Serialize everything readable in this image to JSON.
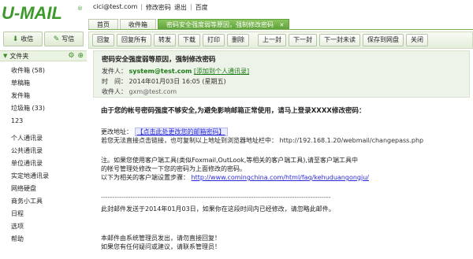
{
  "logo": {
    "brand": "U-MAIL",
    "reg": "®"
  },
  "left_toolbar": {
    "receive": "收信",
    "write": "写信"
  },
  "folder_header": {
    "label": "文件夹"
  },
  "folders": [
    "收件箱 (58)",
    "草稿箱",
    "发件箱",
    "垃圾箱 (33)",
    "123"
  ],
  "nav": [
    "个人通讯录",
    "公共通讯录",
    "单位通讯录",
    "实定地通讯录",
    "网络硬盘",
    "商务小工具",
    "日程",
    "选项",
    "帮助"
  ],
  "userbar": {
    "email": "cici@test.com",
    "sep1": "|",
    "change_pwd": "修改密码",
    "logout": "退出",
    "sep2": "|",
    "baidu": "百度"
  },
  "tabs": [
    {
      "label": "首页"
    },
    {
      "label": "收件箱"
    },
    {
      "label": "密码安全强度弱等原因，强制修改密码",
      "close": "✕"
    }
  ],
  "toolbar": [
    "回复",
    "回复所有",
    "转发",
    "下载",
    "打印",
    "删除",
    "上一封",
    "下一封",
    "下一封未读",
    "保存到网盘",
    "关闭"
  ],
  "message": {
    "subject": "密码安全强度弱等原因，强制修改密码",
    "sender_label": "发件人：",
    "sender": "system@test.com",
    "add_contact": "[添加到个人通讯录]",
    "time_label": "时　间：",
    "time": "2014年01月03日 16:05 (星期五)",
    "recipient_label": "收件人：",
    "recipient": "gxm@test.com"
  },
  "body": {
    "title": "由于您的帐号密码强度不够安全,为避免影响邮箱正常使用，请马上登录XXXX修改密码：",
    "change_label": "更改地址：",
    "change_link": "【点击此处更改您的邮箱密码】",
    "copy_hint": "若您无法直接点击链接，也可复制以上地址到浏览器地址栏中：",
    "copy_url": "http://192.168.1.20/webmail/changepass.php",
    "note1": "注。如果您使用客户端工具(类似Foxmail,OutLook,等相关的客户端工具),请至客户端工具中",
    "note2": "的帐号管理处修改一下您的密码为上面修改的密码。",
    "note3_prefix": "以下为相关的客户端设置步骤：",
    "note3_link": "http://www.comingchina.com/html/faq/kehuduangongju/",
    "dash_line": "-----------------------------------------------------------------------------------------------------",
    "notice": "此封邮件发送于2014年01月03日，如果你在这段时间内已经修改，请忽略此邮件。",
    "footer1": "本邮件由系统管理员发出，请勿直接回复！",
    "footer2": "如果您有任何疑问或建议，请联系管理员！"
  }
}
